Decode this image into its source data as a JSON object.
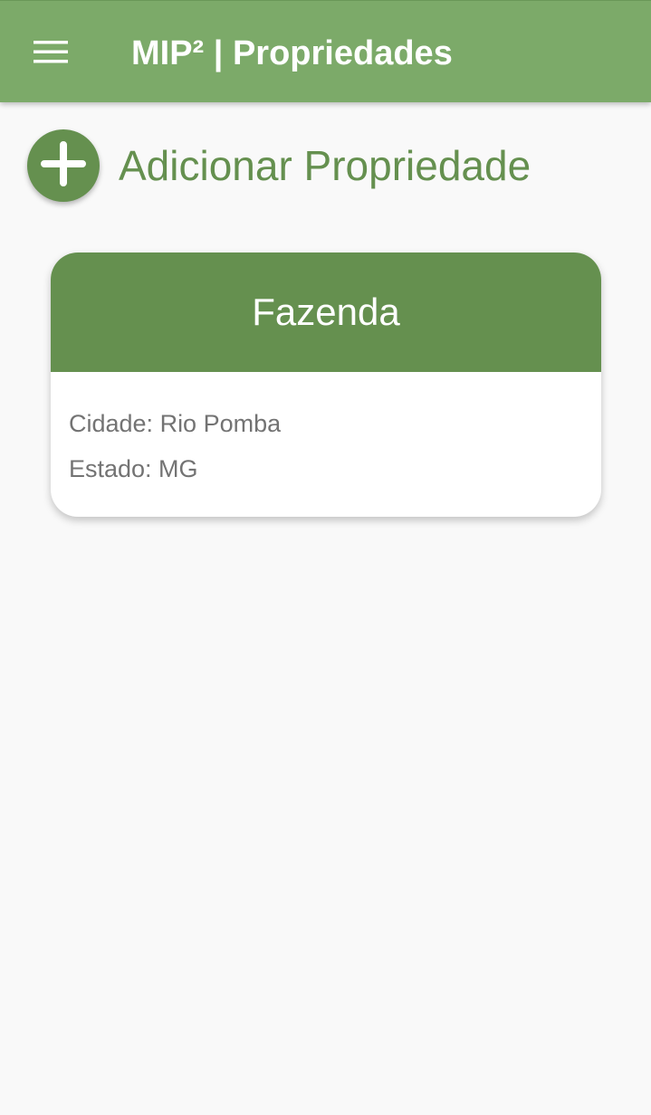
{
  "app_bar": {
    "title": "MIP² | Propriedades",
    "menu_icon": "hamburger-menu-icon",
    "background_color": "#7caa69"
  },
  "add_property": {
    "label": "Adicionar Propriedade",
    "icon": "plus-icon",
    "accent_color": "#65904f"
  },
  "properties": [
    {
      "name": "Fazenda",
      "city_line": "Cidade: Rio Pomba",
      "state_line": "Estado: MG"
    }
  ],
  "colors": {
    "primary": "#65904f",
    "app_bar": "#7caa69",
    "background": "#f9f9f9",
    "body_text": "#737373"
  }
}
